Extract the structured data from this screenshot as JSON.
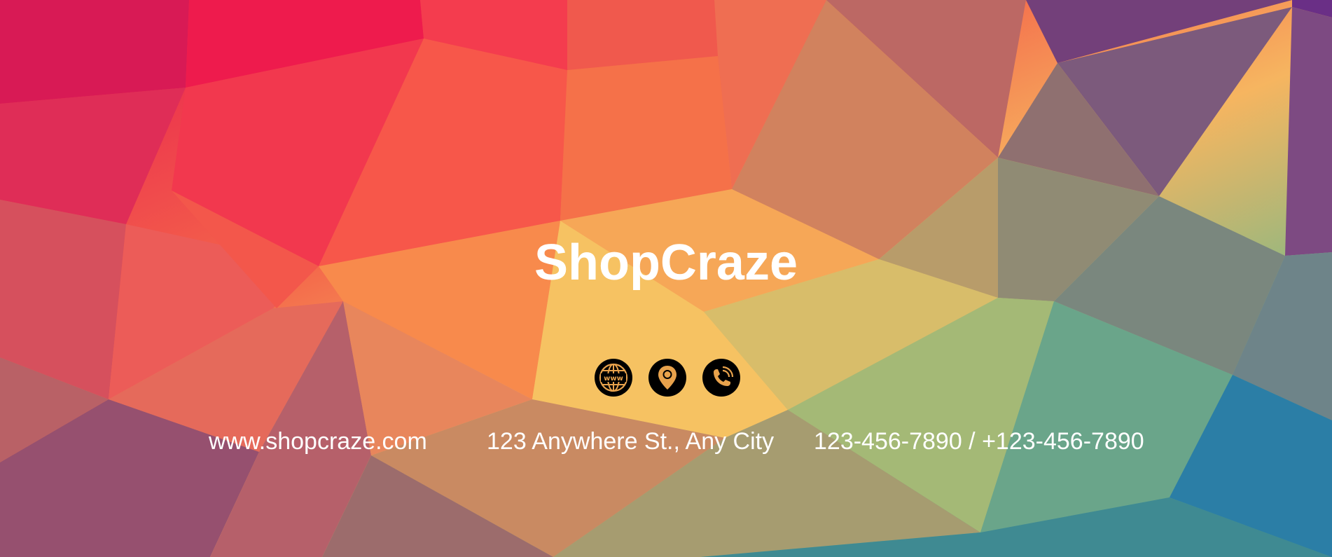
{
  "banner": {
    "brand": "ShopCraze",
    "contacts": {
      "website": "www.shopcraze.com",
      "address": "123 Anywhere St., Any City",
      "phone": "123-456-7890 / +123-456-7890"
    },
    "icons": [
      "globe-www-icon",
      "location-pin-icon",
      "phone-icon"
    ],
    "colors": {
      "text": "#ffffff",
      "icon_bg": "#000000",
      "icon_fg": "#e8a24c"
    }
  }
}
